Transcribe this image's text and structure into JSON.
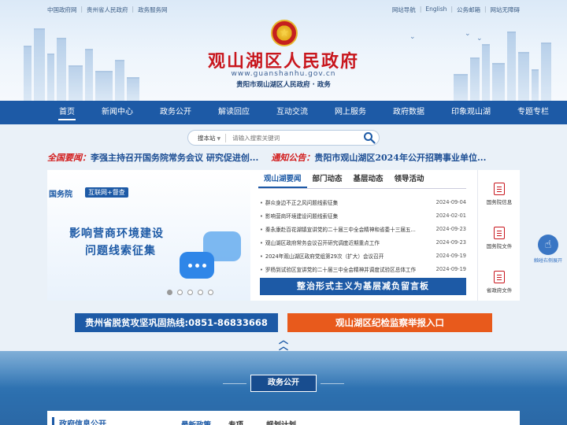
{
  "top_links_left": [
    "中国政府网",
    "贵州省人民政府",
    "政务服务网"
  ],
  "top_links_right": [
    "网站导航",
    "English",
    "公务邮箱",
    "网站无障碍"
  ],
  "header": {
    "title": "观山湖区人民政府",
    "url": "www.guanshanhu.gov.cn",
    "subtitle": "贵阳市观山湖区人民政府 · 政务"
  },
  "nav": [
    "首页",
    "新闻中心",
    "政务公开",
    "解读回应",
    "互动交流",
    "网上服务",
    "政府数据",
    "印象观山湖",
    "专题专栏"
  ],
  "search": {
    "scope": "搜本站",
    "placeholder": "请输入搜索关键词"
  },
  "ticker": {
    "label1": "全国要闻：",
    "text1": "李强主持召开国务院常务会议 研究促进创...",
    "label2": "通知公告：",
    "text2": "贵阳市观山湖区2024年公开招聘事业单位..."
  },
  "banner": {
    "org": "国务院",
    "tag": "互联网+督查",
    "line1": "影响营商环境建设",
    "line2": "问题线索征集",
    "pages": 5,
    "active_page": 1
  },
  "tabs": [
    "观山湖要闻",
    "部门动态",
    "基层动态",
    "领导活动"
  ],
  "news": [
    {
      "title": "群众身边不正之风问题线索征集",
      "date": "2024-09-04"
    },
    {
      "title": "影响营商环境建设问题线索征集",
      "date": "2024-02-01"
    },
    {
      "title": "秦永康赴百花湖镇宣讲党的二十届三中全会精神和省委十三届五...",
      "date": "2024-09-23"
    },
    {
      "title": "观山湖区政府常务会议召开研究调度近期重点工作",
      "date": "2024-09-23"
    },
    {
      "title": "2024年观山湖区政府党组第29次（扩大）会议召开",
      "date": "2024-09-19"
    },
    {
      "title": "罗杨到试验区宣讲党的二十届三中全会精神并调度试验区总体工作",
      "date": "2024-09-19"
    }
  ],
  "blue_bar": "整治形式主义为基层减负留言板",
  "side": [
    "国务院信息",
    "国务院文件",
    "省政府文件"
  ],
  "touch_label": "触碰右侧展开",
  "hotline1": "贵州省脱贫攻坚巩固热线:0851-86833668",
  "hotline2": "观山湖区纪检监察举报入口",
  "section_title": "政务公开",
  "card": {
    "h": "政府信息公开",
    "t2": "最新政策",
    "t3": "专项",
    "t4": "规划计划"
  },
  "colors": {
    "nav": "#1d5aa6",
    "title_red": "#c8161d",
    "orange": "#e85a1c"
  }
}
